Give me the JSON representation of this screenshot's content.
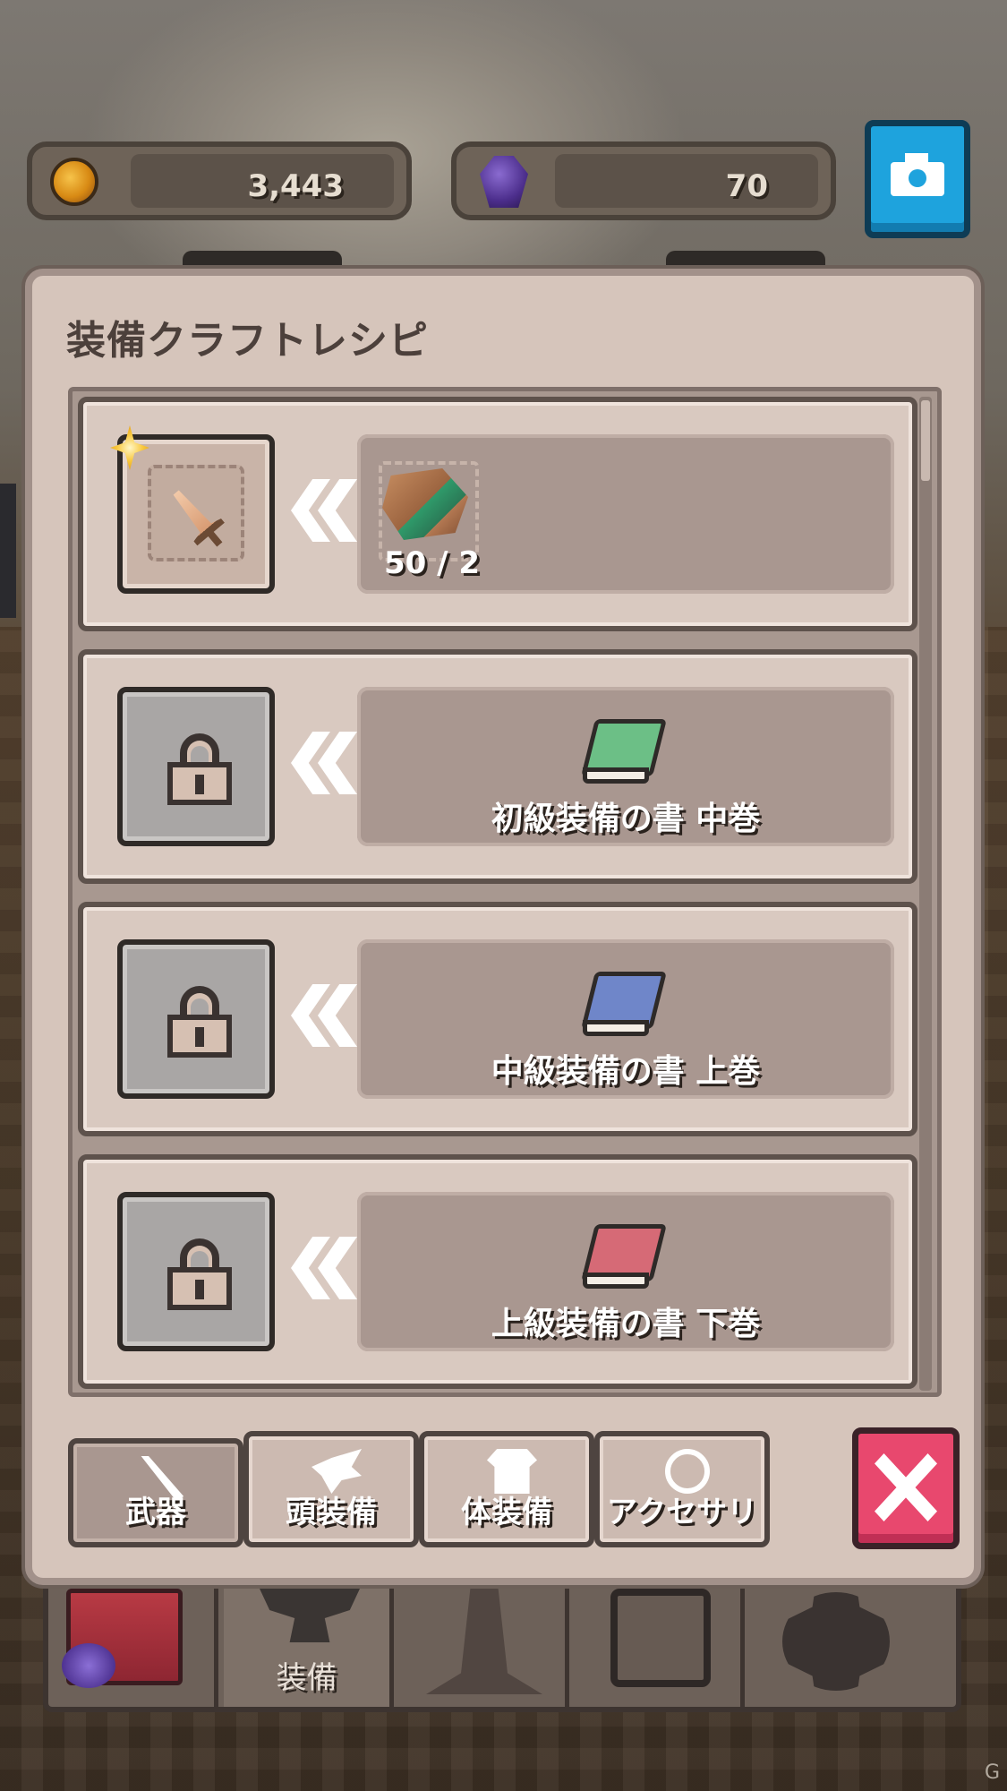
{
  "currencies": {
    "coins": {
      "value": "3,443",
      "icon": "gold-coin-icon"
    },
    "gems": {
      "value": "70",
      "icon": "purple-gem-icon"
    }
  },
  "camera_button": {
    "icon": "camera-icon",
    "color": "#1ea3dd"
  },
  "panel": {
    "title": "装備クラフトレシピ"
  },
  "recipes": [
    {
      "state": "unlocked",
      "result_icon": "sword-icon",
      "badge_icon": "star-badge-icon",
      "material_icon": "parchment-icon",
      "material_count": "50 / 2"
    },
    {
      "state": "locked",
      "result_icon": "lock-icon",
      "book_icon": "green-book-icon",
      "book_color": "#6cbf86",
      "book_name": "初級装備の書 中巻"
    },
    {
      "state": "locked",
      "result_icon": "lock-icon",
      "book_icon": "blue-book-icon",
      "book_color": "#6f86c9",
      "book_name": "中級装備の書 上巻"
    },
    {
      "state": "locked",
      "result_icon": "lock-icon",
      "book_icon": "red-book-icon",
      "book_color": "#d66a76",
      "book_name": "上級装備の書 下巻"
    }
  ],
  "filter_tabs": [
    {
      "label": "武器",
      "icon": "blade-icon",
      "active": true
    },
    {
      "label": "頭装備",
      "icon": "helmet-icon",
      "active": false
    },
    {
      "label": "体装備",
      "icon": "armor-icon",
      "active": false
    },
    {
      "label": "アクセサリ",
      "icon": "ring-icon",
      "active": false
    }
  ],
  "close_button": {
    "icon": "close-icon",
    "color": "#e8486e"
  },
  "bottom_nav": [
    {
      "label": "",
      "icon": "treasure-chest-icon"
    },
    {
      "label": "装備",
      "icon": "anvil-icon",
      "active": true
    },
    {
      "label": "",
      "icon": "tower-icon"
    },
    {
      "label": "",
      "icon": "lock-icon"
    },
    {
      "label": "",
      "icon": "gear-icon"
    }
  ],
  "watermark": "G"
}
